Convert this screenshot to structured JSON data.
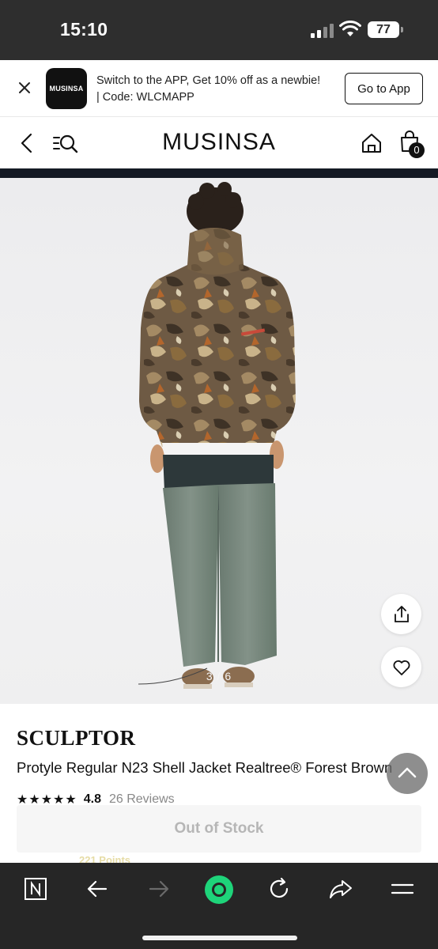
{
  "status_bar": {
    "time": "15:10",
    "battery": "77",
    "icons": [
      "cellular-signal-icon",
      "wifi-icon",
      "battery-icon"
    ]
  },
  "app_banner": {
    "logo_text": "MUSINSA",
    "message_line1": "Switch to the APP, Get 10% off as a newbie!",
    "message_line2": "| Code: WLCMAPP",
    "button_label": "Go to App",
    "icons": [
      "close-icon"
    ]
  },
  "nav": {
    "logo": "MUSINSA",
    "cart_count": "0",
    "icons": [
      "back-arrow-icon",
      "menu-search-icon",
      "home-icon",
      "shopping-bag-icon"
    ]
  },
  "gallery": {
    "counter": "3 / 6",
    "current_image": 3,
    "total_images": 6,
    "icons": [
      "share-icon",
      "heart-icon"
    ]
  },
  "product": {
    "brand": "SCULPTOR",
    "name": "Protyle Regular N23 Shell Jacket Realtree® Forest Brown",
    "stars": "★★★★★",
    "rating": "4.8",
    "reviews": "26 Reviews",
    "buy_button": "Out of Stock",
    "points_peek": "221 Points"
  },
  "browser_bar": {
    "icons": [
      "n-logo-icon",
      "back-arrow-icon",
      "forward-arrow-icon",
      "green-circle-icon",
      "reload-icon",
      "share-arrow-icon",
      "menu-icon"
    ]
  },
  "colors": {
    "status_bar_bg": "#2e2e2e",
    "browser_bar_bg": "#262626",
    "accent_green": "#1ed47a",
    "text_primary": "#111111",
    "out_of_stock_text": "#b6b6b6"
  }
}
